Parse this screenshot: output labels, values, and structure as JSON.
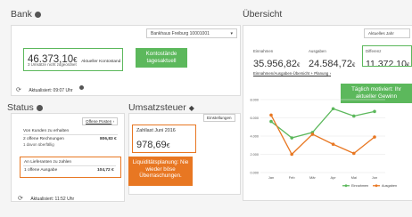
{
  "bank": {
    "title": "Bank",
    "account_select": "Bankhaus Freiburg 10001001",
    "balance_amount": "46.373,10",
    "balance_currency": "€",
    "balance_label": "Aktueller Kontostand",
    "balance_sub": "3 Umsätze nicht zugeordnet",
    "callout": "Kontostände tagesaktuell",
    "updated": "Aktualisiert: 09:07 Uhr"
  },
  "status": {
    "title": "Status",
    "offene_posten_btn": "Offene Posten",
    "receivables_heading": "Von Kunden zu erhalten",
    "receivables_line": "2 offene Rechnungen",
    "receivables_value": "806,83 €",
    "receivables_sub": "1 davon überfällig",
    "payables_heading": "An Lieferanten zu zahlen",
    "payables_line": "1 offene Ausgabe",
    "payables_value": "104,72 €",
    "callout": "Liquiditätsplanung: Nie wieder böse Überraschungen.",
    "updated": "Aktualisiert: 11:52 Uhr"
  },
  "vat": {
    "title": "Umsatzsteuer",
    "settings_btn": "Einstellungen",
    "due_label": "Zahllast Juni 2016",
    "due_amount": "978,69",
    "due_currency": "€"
  },
  "overview": {
    "title": "Übersicht",
    "period_select": "Aktuelles Jahr",
    "income_label": "Einnahmen",
    "income_value": "35.956,82",
    "income_currency": "€",
    "expenses_label": "Ausgaben",
    "expenses_value": "24.584,72",
    "expenses_currency": "€",
    "diff_label": "Differenz",
    "diff_value": "11.372,10",
    "diff_currency": "€",
    "link": "Einnahmen/Ausgaben-Übersicht + Planung",
    "callout": "Täglich motiviert: Ihr aktueller Gewinn"
  },
  "chart_data": {
    "type": "line",
    "categories": [
      "Jan",
      "Feb",
      "Mär",
      "Apr",
      "Mai",
      "Jun"
    ],
    "yticks": [
      "0.000",
      "2.000",
      "4.000",
      "6.000",
      "8.000"
    ],
    "ylim": [
      0,
      8000
    ],
    "series": [
      {
        "name": "Einnahmen",
        "color": "#5cb85c",
        "values": [
          5600,
          3800,
          4400,
          7000,
          6200,
          6700
        ]
      },
      {
        "name": "Ausgaben",
        "color": "#e87722",
        "values": [
          6300,
          2000,
          4200,
          3100,
          2100,
          3900
        ]
      }
    ]
  }
}
